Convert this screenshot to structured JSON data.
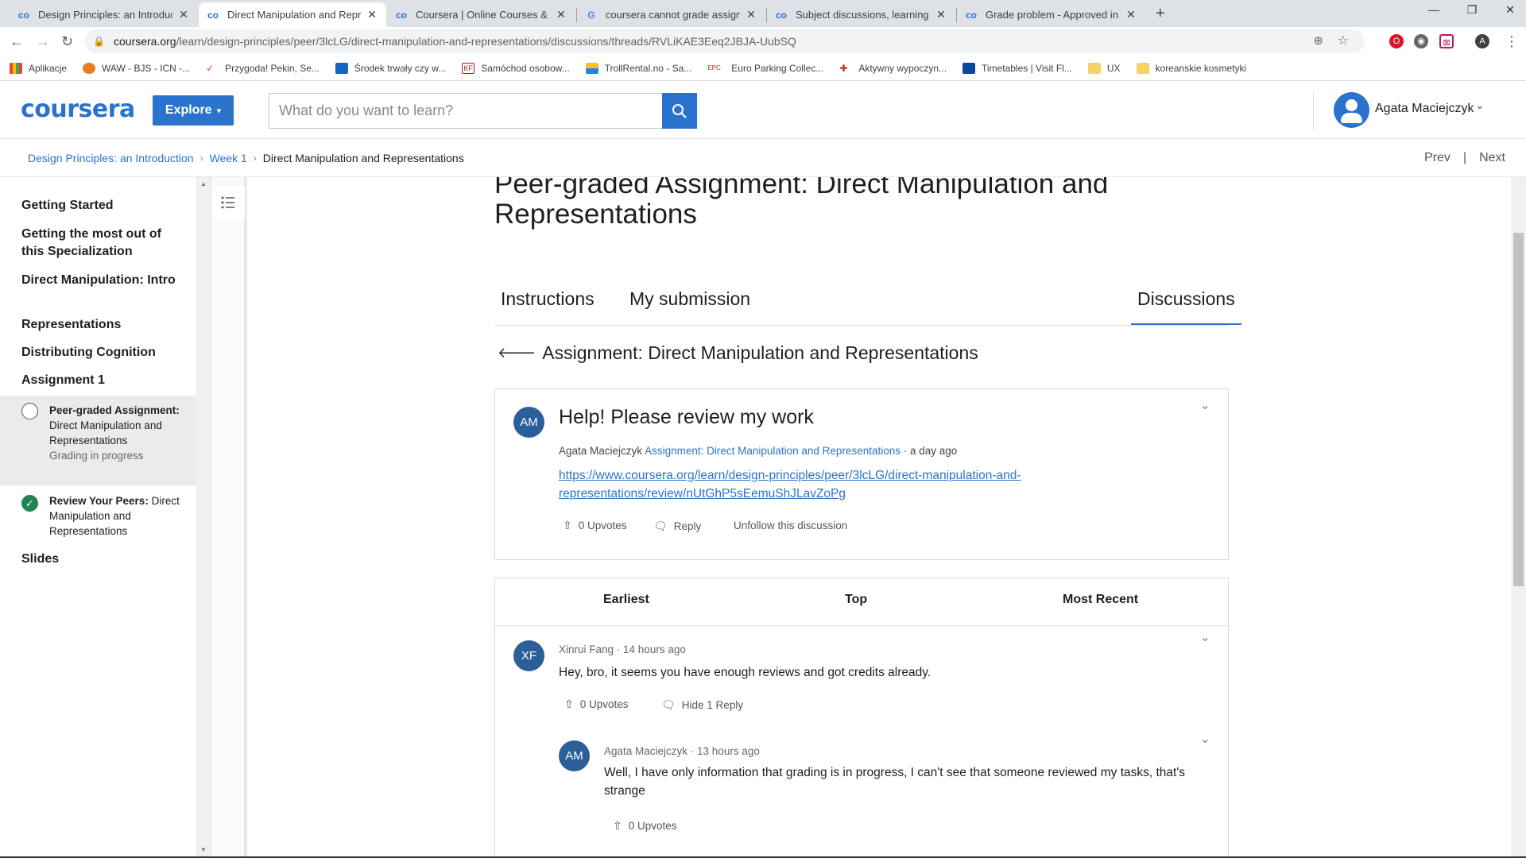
{
  "browser": {
    "tabs": [
      {
        "title": "Design Principles: an Introductio",
        "favicon": "co"
      },
      {
        "title": "Direct Manipulation and Represe",
        "favicon": "co"
      },
      {
        "title": "Coursera | Online Courses & Cre",
        "favicon": "co"
      },
      {
        "title": "coursera cannot grade assignme",
        "favicon": "G"
      },
      {
        "title": "Subject discussions, learning tips",
        "favicon": "co"
      },
      {
        "title": "Grade problem - Approved in rev",
        "favicon": "co"
      }
    ],
    "url_host": "coursera.org",
    "url_path": "/learn/design-principles/peer/3lcLG/direct-manipulation-and-representations/discussions/threads/RVLiKAE3Eeq2JBJA-UubSQ",
    "profile_initial": "A",
    "bookmarks": [
      "Aplikacje",
      "WAW - BJS - ICN -...",
      "Przygoda! Pekin, Se...",
      "Środek trwały czy w...",
      "Samóchod osobow...",
      "TrollRental.no - Sa...",
      "Euro Parking Collec...",
      "Aktywny wypoczyn...",
      "Timetables | Visit Fl...",
      "UX",
      "koreanskie kosmetyki"
    ],
    "bookmark_prefixes": [
      "",
      "",
      "",
      "",
      "KF",
      "",
      "EPC",
      "",
      "",
      "",
      ""
    ]
  },
  "header": {
    "logo": "coursera",
    "explore_label": "Explore",
    "search_placeholder": "What do you want to learn?",
    "user_name": "Agata Maciejczyk"
  },
  "breadcrumb": {
    "items": [
      "Design Principles: an Introduction",
      "Week 1"
    ],
    "current": "Direct Manipulation and Representations",
    "prev": "Prev",
    "next": "Next"
  },
  "sidebar": {
    "items": [
      "Getting Started",
      "Getting the most out of this Specialization",
      "Direct Manipulation: Intro",
      "Representations",
      "Distributing Cognition",
      "Assignment 1"
    ],
    "subitems": [
      {
        "bold": "Peer-graded Assignment:",
        "text": "Direct Manipulation and Representations",
        "status": "Grading in progress"
      },
      {
        "bold": "Review Your Peers:",
        "text": "Direct Manipulation and Representations",
        "status": ""
      }
    ],
    "last_item": "Slides"
  },
  "main": {
    "title": "Peer-graded Assignment: Direct Manipulation and Representations",
    "tabs": [
      "Instructions",
      "My submission",
      "Discussions"
    ],
    "back_label": "Assignment: Direct Manipulation and Representations",
    "thread": {
      "avatar": "AM",
      "title": "Help! Please review my work",
      "author": "Agata Maciejczyk",
      "forum": "Assignment: Direct Manipulation and Representations",
      "time": "· a day ago",
      "link": "https://www.coursera.org/learn/design-principles/peer/3lcLG/direct-manipulation-and-representations/review/nUtGhP5sEemuShJLavZoPg",
      "upvotes": "0 Upvotes",
      "reply": "Reply",
      "unfollow": "Unfollow this discussion"
    },
    "sort": [
      "Earliest",
      "Top",
      "Most Recent"
    ],
    "replies": [
      {
        "avatar": "XF",
        "meta": "Xinrui Fang · 14 hours ago",
        "text": "Hey, bro, it seems you have enough reviews and got credits already.",
        "upvotes": "0 Upvotes",
        "hide": "Hide 1 Reply"
      },
      {
        "avatar": "AM",
        "meta": "Agata Maciejczyk · 13 hours ago",
        "text": "Well, I have only information that grading is in progress, I can't see that someone reviewed my tasks, that's strange",
        "upvotes": "0 Upvotes"
      }
    ]
  }
}
